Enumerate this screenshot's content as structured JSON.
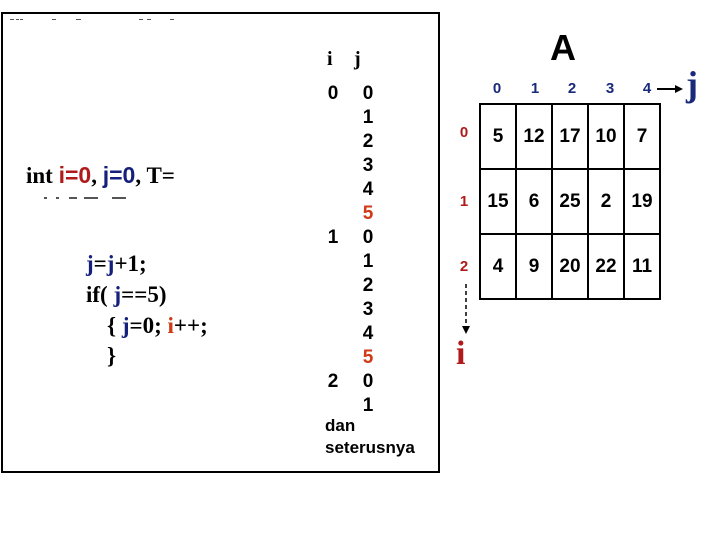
{
  "colors": {
    "i_red": "#b11a1a",
    "j_blue": "#14207c",
    "highlight_orange": "#d03a18",
    "index_navy": "#1a2a7a"
  },
  "code": {
    "decl": {
      "kw": "int ",
      "i": "i=0",
      "sep1": ", ",
      "j": "j=0",
      "sep2": ", ",
      "t": "T= "
    },
    "line1": {
      "j1": "j",
      "eq": "=",
      "j2": "j",
      "rest": "+1;"
    },
    "line2": {
      "pre": "if( ",
      "j": "j",
      "rest": "==5)"
    },
    "line3": {
      "open": "{ ",
      "j": "j",
      "mid": "=0; ",
      "i": "i",
      "rest": "++;"
    },
    "line4": "}"
  },
  "trace": {
    "headers": {
      "i": "i",
      "j": "j"
    },
    "i_values": [
      "0",
      "1",
      "2"
    ],
    "j_values": [
      "0",
      "1",
      "2",
      "3",
      "4",
      "5",
      "0",
      "1",
      "2",
      "3",
      "4",
      "5",
      "0",
      "1"
    ],
    "highlight_value": "5",
    "footer_line1": "dan",
    "footer_line2": "seterusnya"
  },
  "array": {
    "name": "A",
    "col_indices": [
      "0",
      "1",
      "2",
      "3",
      "4"
    ],
    "row_indices": [
      "0",
      "1",
      "2"
    ],
    "j_axis_label": "j",
    "i_axis_label": "i",
    "cells": [
      [
        "5",
        "12",
        "17",
        "10",
        "7"
      ],
      [
        "15",
        "6",
        "25",
        "2",
        "19"
      ],
      [
        "4",
        "9",
        "20",
        "22",
        "11"
      ]
    ]
  }
}
